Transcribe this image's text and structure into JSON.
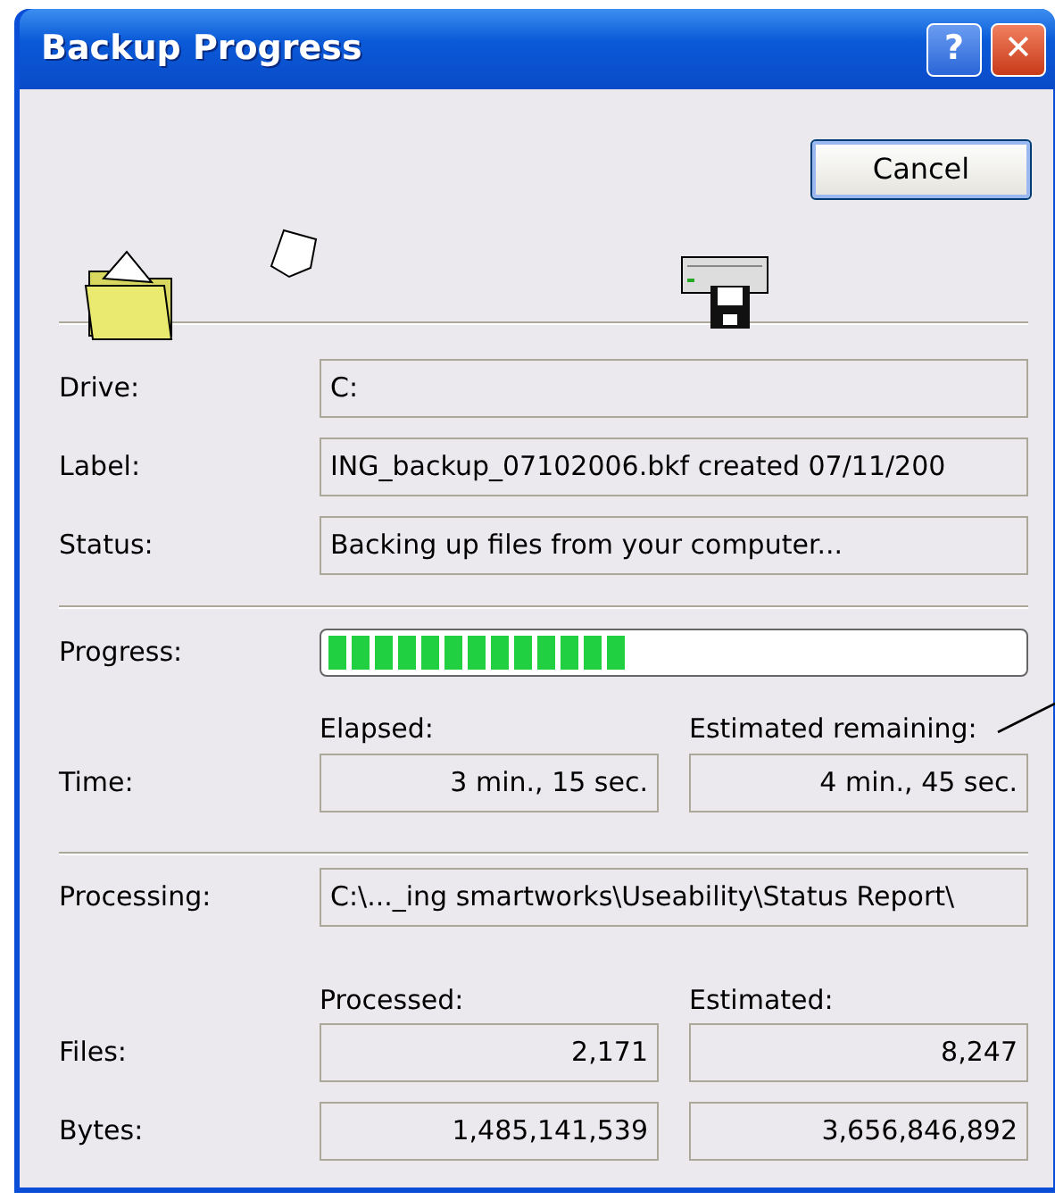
{
  "window": {
    "title": "Backup Progress",
    "buttons": [
      "?",
      "✕"
    ]
  },
  "cancel_button": "Cancel",
  "fields": [
    {
      "label": "Drive:",
      "value": "C:"
    },
    {
      "label": "Label:",
      "value": "ING_backup_07102006.bkf created 07/11/200"
    },
    {
      "label": "Status:",
      "value": "Backing up files from your computer..."
    }
  ],
  "progress": {
    "label": "Progress:",
    "level": 0.43
  },
  "time": {
    "label": "Time:",
    "headers": [
      "Elapsed:",
      "Estimated remaining:"
    ],
    "values": [
      "3 min., 15 sec.",
      "4 min., 45 sec."
    ]
  },
  "processing": {
    "label": "Processing:",
    "value": "C:\\..._ing smartworks\\Useability\\Status Report\\"
  },
  "counts": {
    "headers": [
      "Processed:",
      "Estimated:"
    ],
    "rows": [
      {
        "label": "Files:",
        "values": [
          "2,171",
          "8,247"
        ]
      },
      {
        "label": "Bytes:",
        "values": [
          "1,485,141,539",
          "3,656,846,892"
        ]
      }
    ]
  }
}
